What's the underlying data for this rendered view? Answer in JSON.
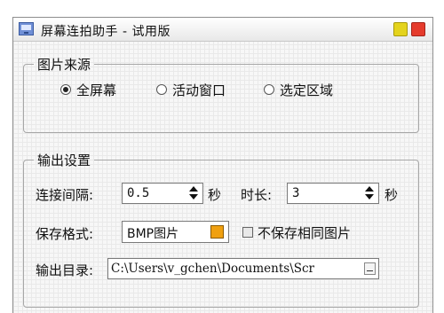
{
  "window": {
    "title": "屏幕连拍助手 - 试用版"
  },
  "source_group": {
    "legend": "图片来源",
    "options": [
      {
        "label": "全屏幕",
        "checked": true
      },
      {
        "label": "活动窗口",
        "checked": false
      },
      {
        "label": "选定区域",
        "checked": false
      }
    ]
  },
  "output_group": {
    "legend": "输出设置",
    "interval": {
      "label": "连接间隔:",
      "value": "0.5",
      "unit": "秒"
    },
    "duration": {
      "label": "时长:",
      "value": "3",
      "unit": "秒"
    },
    "format": {
      "label": "保存格式:",
      "value": "BMP图片",
      "swatch_color": "#f0a010"
    },
    "skip_duplicates": {
      "label": "不保存相同图片",
      "checked": false
    },
    "output_dir": {
      "label": "输出目录:",
      "value": "C:\\Users\\v_gchen\\Documents\\Scr"
    }
  },
  "colors": {
    "minimize_button": "#e4d31c",
    "close_button": "#e53b2c"
  }
}
